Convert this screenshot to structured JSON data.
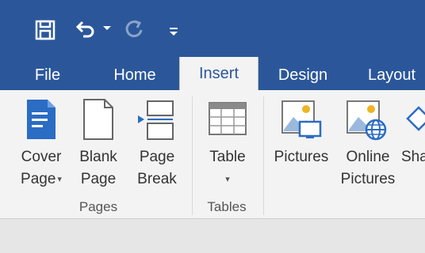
{
  "quick_access": {
    "save_icon": "save-icon",
    "undo_icon": "undo-icon",
    "redo_icon": "redo-icon",
    "customize_icon": "customize-qat-icon"
  },
  "tabs": [
    "File",
    "Home",
    "Insert",
    "Design",
    "Layout"
  ],
  "active_tab": "Insert",
  "groups": {
    "pages": {
      "label": "Pages",
      "commands": [
        {
          "line1": "Cover",
          "line2": "Page",
          "icon": "cover-page-icon",
          "has_dropdown": true
        },
        {
          "line1": "Blank",
          "line2": "Page",
          "icon": "blank-page-icon"
        },
        {
          "line1": "Page",
          "line2": "Break",
          "icon": "page-break-icon"
        }
      ]
    },
    "tables": {
      "label": "Tables",
      "commands": [
        {
          "line1": "Table",
          "icon": "table-icon",
          "has_dropdown": true
        }
      ]
    },
    "illustrations": {
      "commands": [
        {
          "line1": "Pictures",
          "icon": "pictures-icon"
        },
        {
          "line1": "Online",
          "line2": "Pictures",
          "icon": "online-pictures-icon"
        },
        {
          "line1": "Sha",
          "icon": "shapes-icon"
        }
      ]
    }
  },
  "colors": {
    "title_bar": "#2b579a",
    "ribbon_bg": "#f3f3f3",
    "document_bg": "#e6e6e6",
    "accent_blue": "#2b6cc4"
  }
}
